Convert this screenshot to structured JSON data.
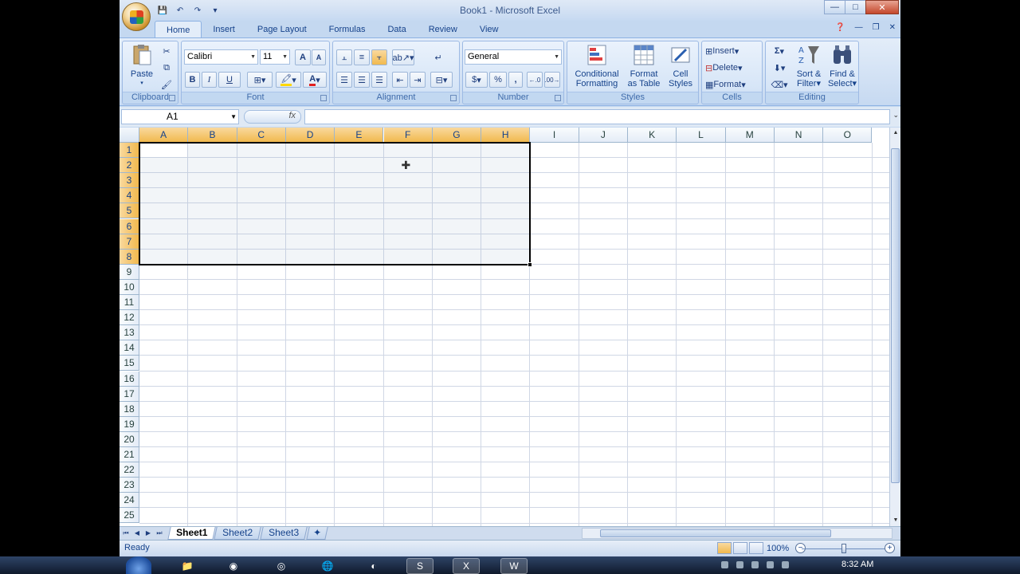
{
  "window": {
    "title": "Book1 - Microsoft Excel",
    "qat": [
      "save-icon",
      "undo-icon",
      "redo-icon",
      "customize-icon"
    ]
  },
  "tabs": [
    "Home",
    "Insert",
    "Page Layout",
    "Formulas",
    "Data",
    "Review",
    "View"
  ],
  "active_tab": "Home",
  "ribbon": {
    "clipboard": {
      "label": "Clipboard",
      "paste": "Paste"
    },
    "font": {
      "label": "Font",
      "font_name": "Calibri",
      "font_size": "11",
      "bold": "B",
      "italic": "I",
      "underline": "U",
      "grow": "A",
      "shrink": "A"
    },
    "alignment": {
      "label": "Alignment"
    },
    "number": {
      "label": "Number",
      "format": "General",
      "currency": "$",
      "percent": "%",
      "comma": ","
    },
    "styles": {
      "label": "Styles",
      "conditional": [
        "Conditional",
        "Formatting"
      ],
      "format_table": [
        "Format",
        "as Table"
      ],
      "cell_styles": [
        "Cell",
        "Styles"
      ]
    },
    "cells": {
      "label": "Cells",
      "insert": "Insert",
      "delete": "Delete",
      "format": "Format"
    },
    "editing": {
      "label": "Editing",
      "sort": [
        "Sort &",
        "Filter"
      ],
      "find": [
        "Find &",
        "Select"
      ],
      "sigma": "Σ"
    }
  },
  "formula_bar": {
    "name_box": "A1",
    "fx": "fx",
    "formula": ""
  },
  "grid": {
    "columns": [
      "A",
      "B",
      "C",
      "D",
      "E",
      "F",
      "G",
      "H",
      "I",
      "J",
      "K",
      "L",
      "M",
      "N",
      "O"
    ],
    "rows": [
      "1",
      "2",
      "3",
      "4",
      "5",
      "6",
      "7",
      "8",
      "9",
      "10",
      "11",
      "12",
      "13",
      "14",
      "15",
      "16",
      "17",
      "18",
      "19",
      "20",
      "21",
      "22",
      "23",
      "24",
      "25"
    ],
    "selection": "A1:H8"
  },
  "sheets": [
    "Sheet1",
    "Sheet2",
    "Sheet3"
  ],
  "active_sheet": "Sheet1",
  "status": {
    "text": "Ready",
    "zoom": "100%"
  },
  "taskbar": {
    "clock": "8:32 AM"
  }
}
